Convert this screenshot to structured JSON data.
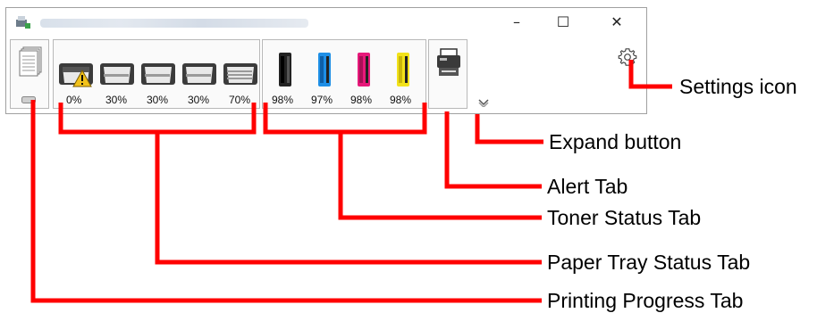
{
  "window": {
    "buttons": {
      "minimize": "–",
      "maximize": "☐",
      "close": "✕"
    }
  },
  "printing_tab": {
    "icon": "document-stack-icon",
    "progress_indicator": "progress-bar-icon"
  },
  "paper_trays": [
    {
      "level": "0%",
      "warning": true
    },
    {
      "level": "30%"
    },
    {
      "level": "30%"
    },
    {
      "level": "30%"
    },
    {
      "level": "70%"
    }
  ],
  "toners": [
    {
      "level": "98%",
      "color": "#1a1a1a"
    },
    {
      "level": "97%",
      "color": "#1e8fe6"
    },
    {
      "level": "98%",
      "color": "#e6197a"
    },
    {
      "level": "98%",
      "color": "#f2e21a"
    }
  ],
  "callouts": {
    "settings": "Settings icon",
    "expand": "Expand button",
    "alert": "Alert Tab",
    "toner": "Toner Status Tab",
    "paper": "Paper Tray Status Tab",
    "printing": "Printing Progress Tab"
  },
  "colors": {
    "callout_red": "#ff0000"
  }
}
